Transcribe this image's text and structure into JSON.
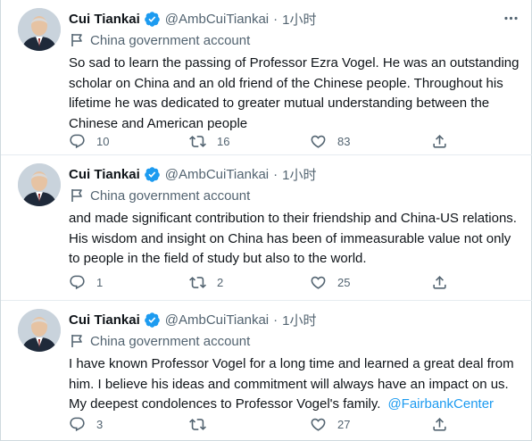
{
  "tweets": [
    {
      "author": {
        "name": "Cui Tiankai",
        "handle": "@AmbCuiTiankai"
      },
      "time": "1小时",
      "label": "China government account",
      "text": "So sad to learn the passing of Professor Ezra Vogel. He was an outstanding\nscholar on China and an old friend of the Chinese people. Throughout his\nlifetime he was dedicated to greater mutual understanding between the\nChinese and American people",
      "mention": "",
      "replies": "10",
      "retweets": "16",
      "likes": "83"
    },
    {
      "author": {
        "name": "Cui Tiankai",
        "handle": "@AmbCuiTiankai"
      },
      "time": "1小时",
      "label": "China government account",
      "text": "and made significant contribution to their friendship and China-US relations.\nHis wisdom and insight on China has been of immeasurable value not only\nto people in the field of study but also to the world.",
      "mention": "",
      "replies": "1",
      "retweets": "2",
      "likes": "25"
    },
    {
      "author": {
        "name": "Cui Tiankai",
        "handle": "@AmbCuiTiankai"
      },
      "time": "1小时",
      "label": "China government account",
      "text": "I have known Professor Vogel for a long time and learned a great deal from\nhim. I believe his ideas and commitment will always have an impact on us.\nMy deepest condolences to Professor Vogel's family.",
      "mention": "@FairbankCenter",
      "replies": "3",
      "retweets": "",
      "likes": "27"
    }
  ],
  "separator": "·",
  "colors": {
    "accent": "#1d9bf0",
    "secondary_text": "#536471",
    "primary_text": "#0f1419"
  },
  "icons": [
    "verified-badge-icon",
    "more-icon",
    "flag-icon",
    "reply-icon",
    "retweet-icon",
    "like-icon",
    "share-icon"
  ]
}
